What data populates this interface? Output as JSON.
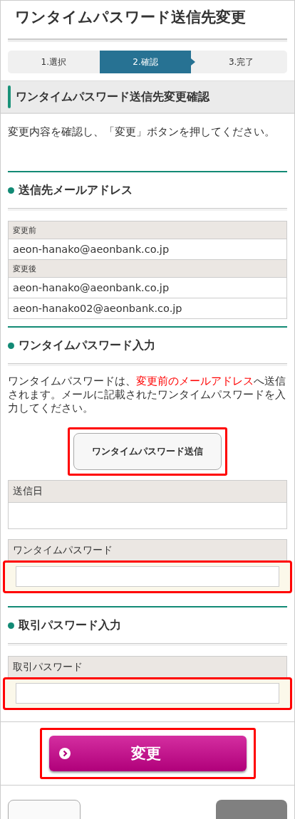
{
  "page_title": "ワンタイムパスワード送信先変更",
  "steps": [
    {
      "label": "1.選択",
      "selected": false
    },
    {
      "label": "2.確認",
      "selected": true
    },
    {
      "label": "3.完了",
      "selected": false
    }
  ],
  "section_title": "ワンタイムパスワード送信先変更確認",
  "intro": "変更内容を確認し、「変更」ボタンを押してください。",
  "email_section": {
    "heading": "送信先メールアドレス",
    "groups": [
      {
        "label": "変更前",
        "values": [
          "aeon-hanako@aeonbank.co.jp"
        ]
      },
      {
        "label": "変更後",
        "values": [
          "aeon-hanako@aeonbank.co.jp",
          "aeon-hanako02@aeonbank.co.jp"
        ]
      }
    ]
  },
  "otp_section": {
    "heading": "ワンタイムパスワード入力",
    "note": [
      {
        "text": "ワンタイムパスワードは、",
        "emphasis": false
      },
      {
        "text": "変更前のメールアドレス",
        "emphasis": true
      },
      {
        "text": "へ送信されます。メールに記載されたワンタイムパスワードを入力してください。",
        "emphasis": false
      }
    ],
    "send_button": {
      "label": "ワンタイムパスワード送信",
      "highlighted": true
    },
    "sent_date_label": "送信日",
    "otp_field": {
      "label": "ワンタイムパスワード",
      "highlighted": true
    }
  },
  "trade_section": {
    "heading": "取引パスワード入力",
    "field": {
      "label": "取引パスワード",
      "highlighted": true
    }
  },
  "submit_button": {
    "label": "変更",
    "highlighted": true
  }
}
